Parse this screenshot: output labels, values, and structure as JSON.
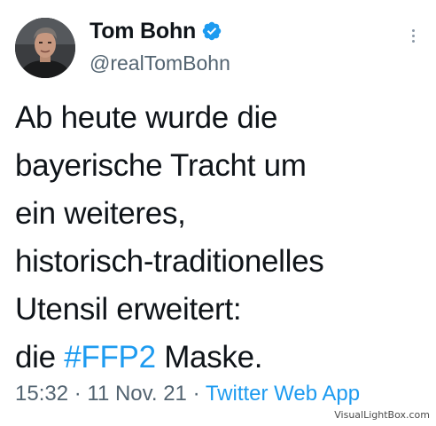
{
  "author": {
    "display_name": "Tom Bohn",
    "handle": "@realTomBohn",
    "verified": true
  },
  "tweet": {
    "lines": [
      "Ab heute wurde die",
      "bayerische Tracht um",
      "ein weiteres,",
      "historisch-traditionelles",
      "Utensil erweitert:"
    ],
    "last_line_prefix": "die ",
    "hashtag": "#FFP2",
    "last_line_suffix": " Maske."
  },
  "meta": {
    "time": "15:32",
    "separator_1": " · ",
    "date": "11 Nov. 21",
    "separator_2": " · ",
    "source": "Twitter Web App"
  },
  "watermark": "VisualLightBox.com",
  "icons": {
    "verified": "verified-badge-icon",
    "more": "more-options-icon"
  },
  "colors": {
    "accent": "#1d9bf0",
    "secondary_text": "#536471",
    "primary_text": "#0f1419"
  }
}
